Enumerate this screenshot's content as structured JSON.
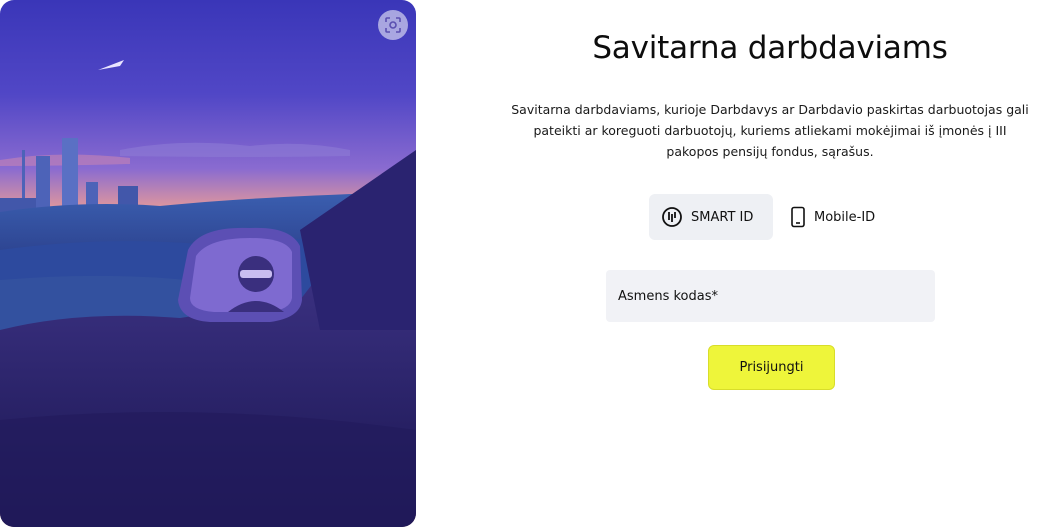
{
  "hero": {
    "scan_icon": "focus-scan-icon"
  },
  "header": {
    "title": "Savitarna darbdaviams"
  },
  "intro": {
    "text": "Savitarna darbdaviams, kurioje Darbdavys ar Darbdavio paskirtas darbuotojas gali pateikti ar koreguoti darbuotojų, kuriems atliekami mokėjimai iš įmonės į III pakopos pensijų fondus, sąrašus."
  },
  "auth": {
    "tabs": [
      {
        "label": "SMART ID",
        "icon": "smart-id-icon",
        "selected": true
      },
      {
        "label": "Mobile-ID",
        "icon": "mobile-phone-icon",
        "selected": false
      }
    ]
  },
  "form": {
    "personal_code_label": "Asmens kodas*",
    "submit_label": "Prisijungti"
  },
  "colors": {
    "accent": "#eef53a",
    "field_bg": "#f1f2f6",
    "tab_selected_bg": "#eef0f4"
  }
}
